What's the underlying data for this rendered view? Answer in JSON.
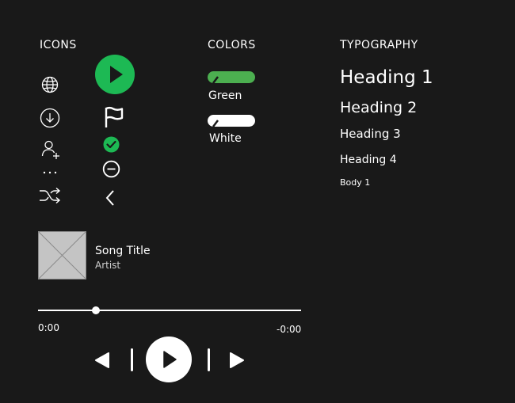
{
  "sections": {
    "icons_title": "ICONS",
    "colors_title": "COLORS",
    "typography_title": "TYPOGRAPHY"
  },
  "colors": {
    "green_label": "Green",
    "white_label": "White",
    "green_hex": "#4caf50",
    "white_hex": "#ffffff",
    "play_green_hex": "#1db954"
  },
  "icons": [
    "globe-icon",
    "download-icon",
    "add-user-icon",
    "more-icon",
    "shuffle-icon",
    "play-icon",
    "flag-icon",
    "check-icon",
    "remove-icon",
    "back-icon"
  ],
  "typography": {
    "h1": "Heading 1",
    "h2": "Heading 2",
    "h3": "Heading 3",
    "h4": "Heading 4",
    "body1": "Body 1"
  },
  "player": {
    "song_title": "Song Title",
    "artist": "Artist",
    "elapsed": "0:00",
    "remaining": "-0:00",
    "progress": 0.22
  }
}
